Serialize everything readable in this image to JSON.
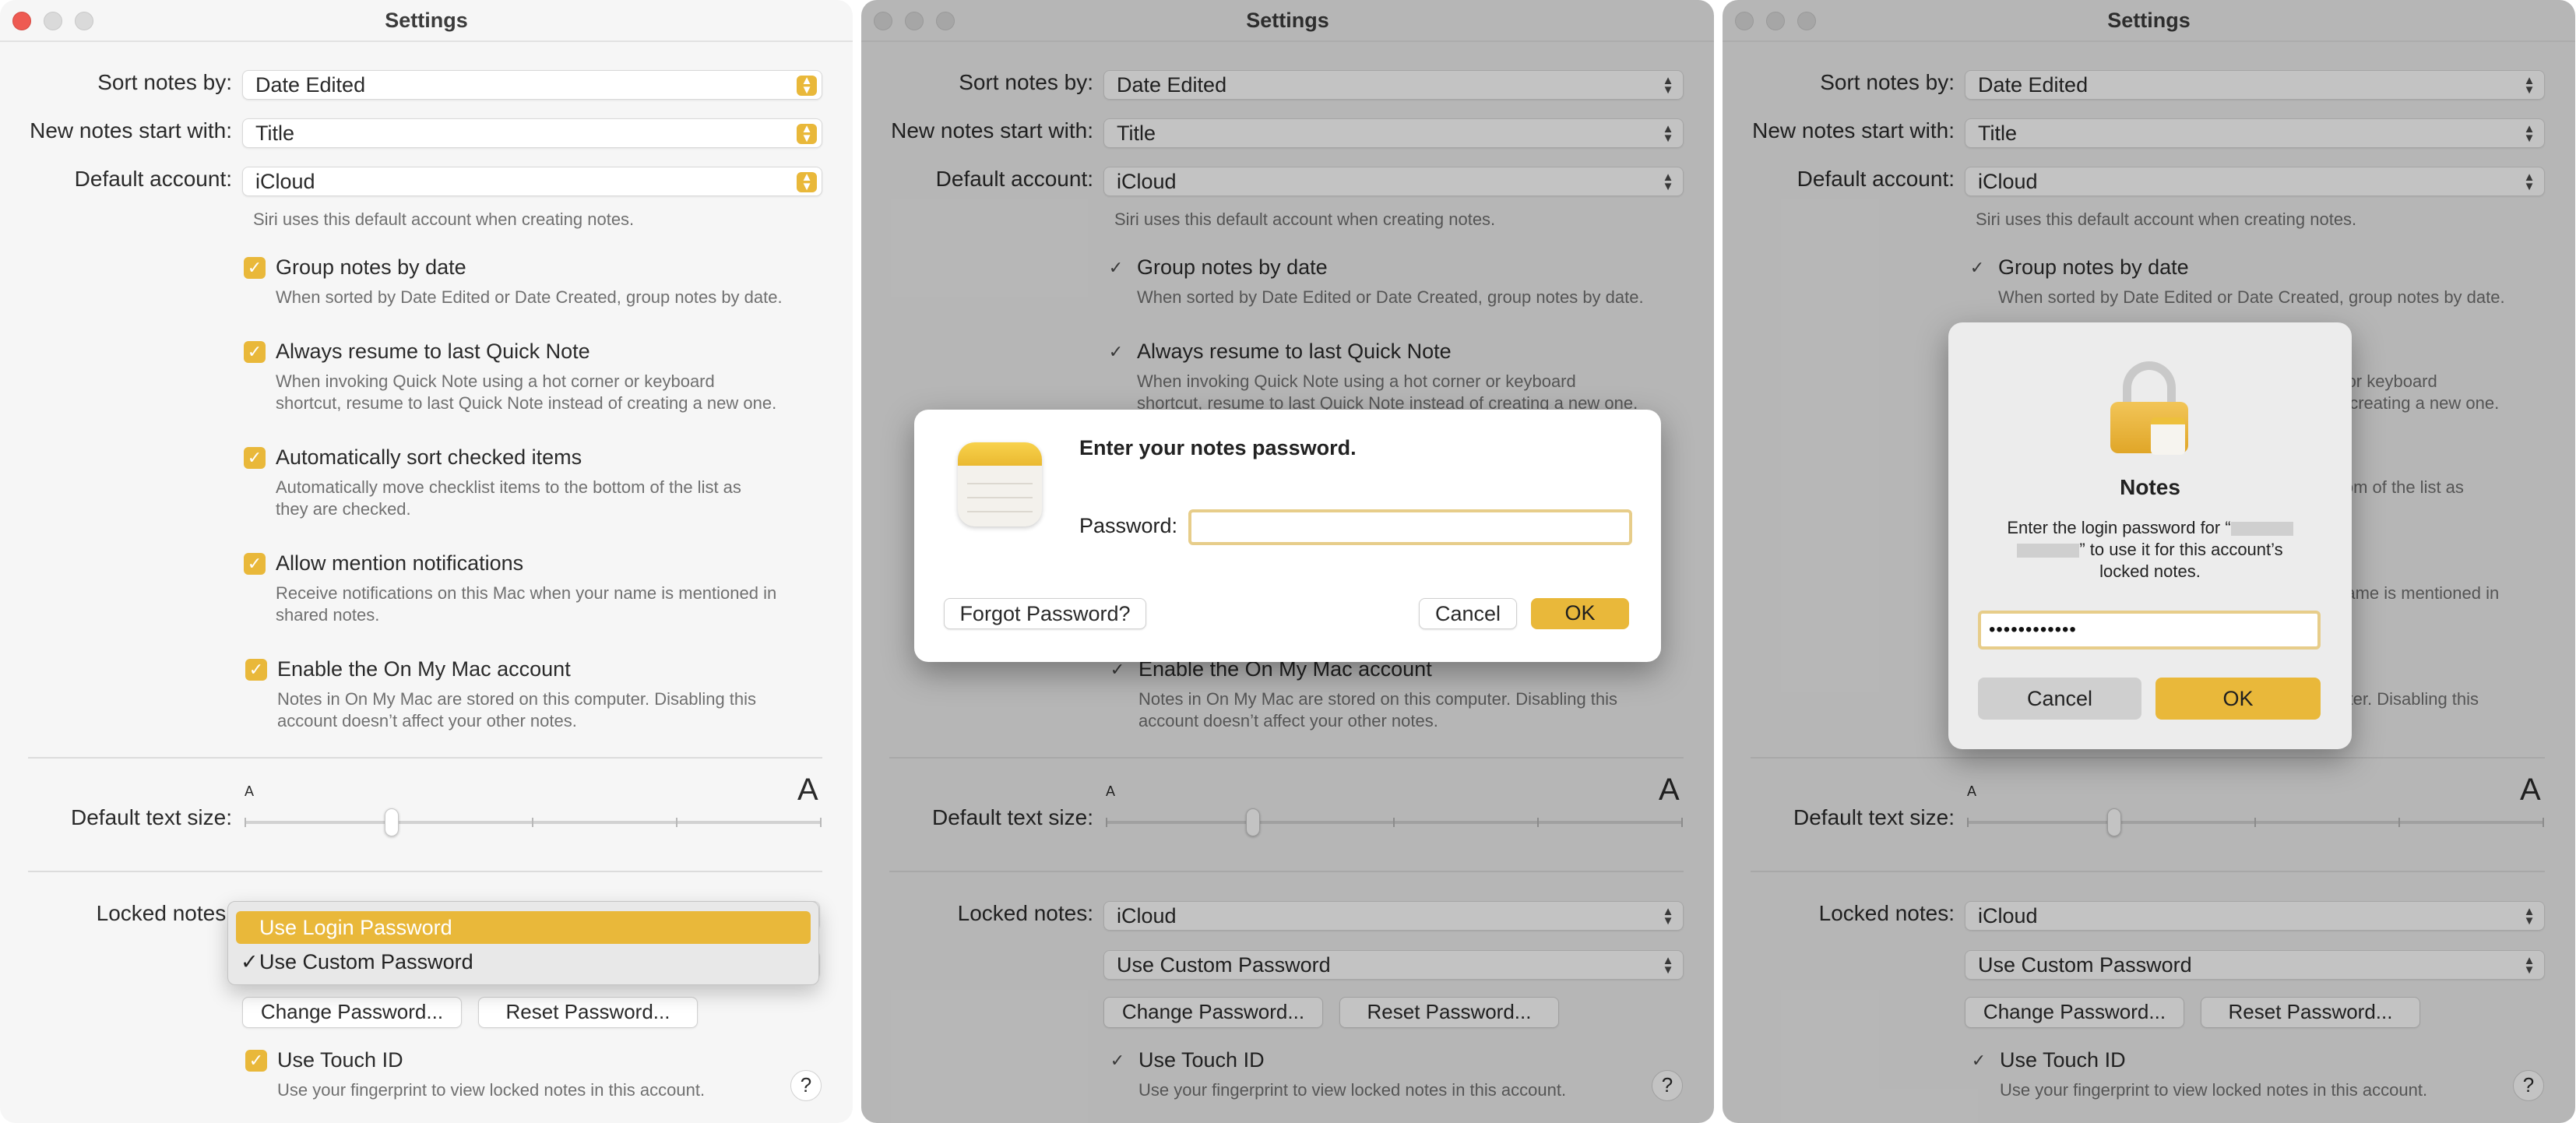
{
  "window_title": "Settings",
  "settings": {
    "sort_label": "Sort notes by:",
    "sort_value": "Date Edited",
    "new_notes_label": "New notes start with:",
    "new_notes_value": "Title",
    "default_account_label": "Default account:",
    "default_account_value": "iCloud",
    "siri_hint": "Siri uses this default account when creating notes.",
    "group": {
      "label": "Group notes by date",
      "hint": "When sorted by Date Edited or Date Created, group notes by date.",
      "checked": true
    },
    "quicknote": {
      "label": "Always resume to last Quick Note",
      "hint1": "When invoking Quick Note using a hot corner or keyboard",
      "hint2": "shortcut, resume to last Quick Note instead of creating a new one.",
      "checked": true
    },
    "autosort": {
      "label": "Automatically sort checked items",
      "hint1": "Automatically move checklist items to the bottom of the list as",
      "hint2": "they are checked.",
      "checked": true
    },
    "mention": {
      "label": "Allow mention notifications",
      "hint1": "Receive notifications on this Mac when your name is mentioned in",
      "hint2": "shared notes.",
      "checked": true
    },
    "onmymac": {
      "label": "Enable the On My Mac account",
      "hint1": "Notes in On My Mac are stored on this computer. Disabling this",
      "hint2": "account doesn’t affect your other notes.",
      "checked": true
    },
    "text_size_label": "Default text size:",
    "text_size_small": "A",
    "text_size_large": "A",
    "text_size_level": 0.25,
    "locked_label": "Locked notes:",
    "locked_value": "iCloud",
    "password_type_value": "Use Custom Password",
    "change_password": "Change Password...",
    "reset_password": "Reset Password...",
    "touchid": {
      "label": "Use Touch ID",
      "hint": "Use your fingerprint to view locked notes in this account.",
      "checked": true
    },
    "help": "?"
  },
  "menu": {
    "items": [
      {
        "label": "Use Login Password",
        "highlighted": true,
        "checked": false
      },
      {
        "label": "Use Custom Password",
        "highlighted": false,
        "checked": true
      }
    ],
    "check_mark": "✓"
  },
  "password_dialog": {
    "title": "Enter your notes password.",
    "password_label": "Password:",
    "password_value": "",
    "forgot": "Forgot Password?",
    "cancel": "Cancel",
    "ok": "OK"
  },
  "login_dialog": {
    "title": "Notes",
    "line1": "Enter the login password for “",
    "line2": "” to use it for this account’s",
    "line3": "locked notes.",
    "password_value": "••••••••••••",
    "cancel": "Cancel",
    "ok": "OK"
  },
  "colors": {
    "accent": "#e9b83a",
    "close": "#ee5a52"
  }
}
